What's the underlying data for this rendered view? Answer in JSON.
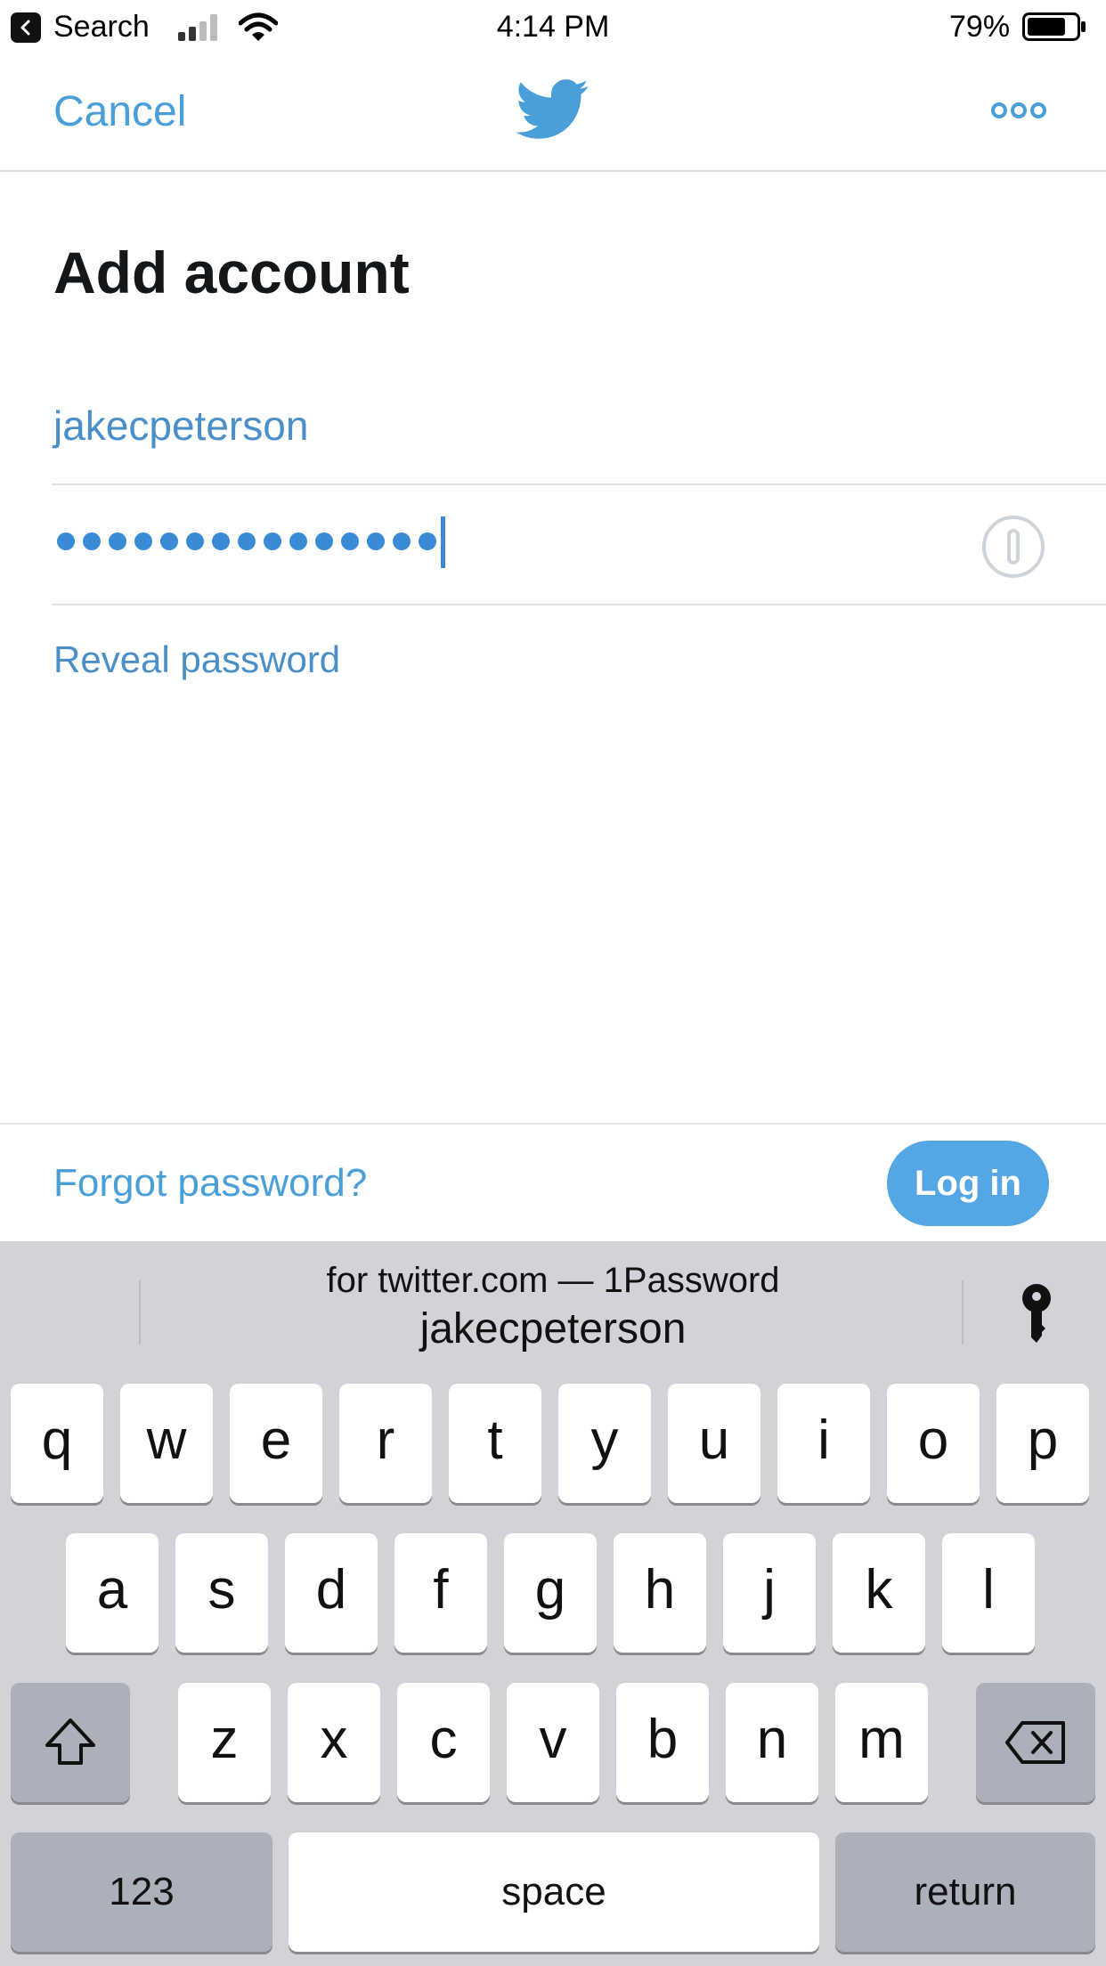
{
  "status_bar": {
    "back_label": "Search",
    "time": "4:14 PM",
    "battery": "79%",
    "battery_level": 0.79
  },
  "nav": {
    "cancel": "Cancel",
    "logo_icon": "twitter-bird-icon",
    "more_icon": "more-dots-icon"
  },
  "form": {
    "title": "Add account",
    "username": "jakecpeterson",
    "password_length": 15,
    "reveal": "Reveal password"
  },
  "footer": {
    "forgot": "Forgot password?",
    "login": "Log in"
  },
  "keyboard": {
    "suggestion_line1": "for twitter.com — 1Password",
    "suggestion_line2": "jakecpeterson",
    "row1": [
      "q",
      "w",
      "e",
      "r",
      "t",
      "y",
      "u",
      "i",
      "o",
      "p"
    ],
    "row2": [
      "a",
      "s",
      "d",
      "f",
      "g",
      "h",
      "j",
      "k",
      "l"
    ],
    "row3": [
      "z",
      "x",
      "c",
      "v",
      "b",
      "n",
      "m"
    ],
    "numbers": "123",
    "space": "space",
    "return": "return"
  },
  "colors": {
    "accent": "#4a9fd8",
    "button": "#54a6e4",
    "keyboard_bg": "#d1d3d9"
  }
}
